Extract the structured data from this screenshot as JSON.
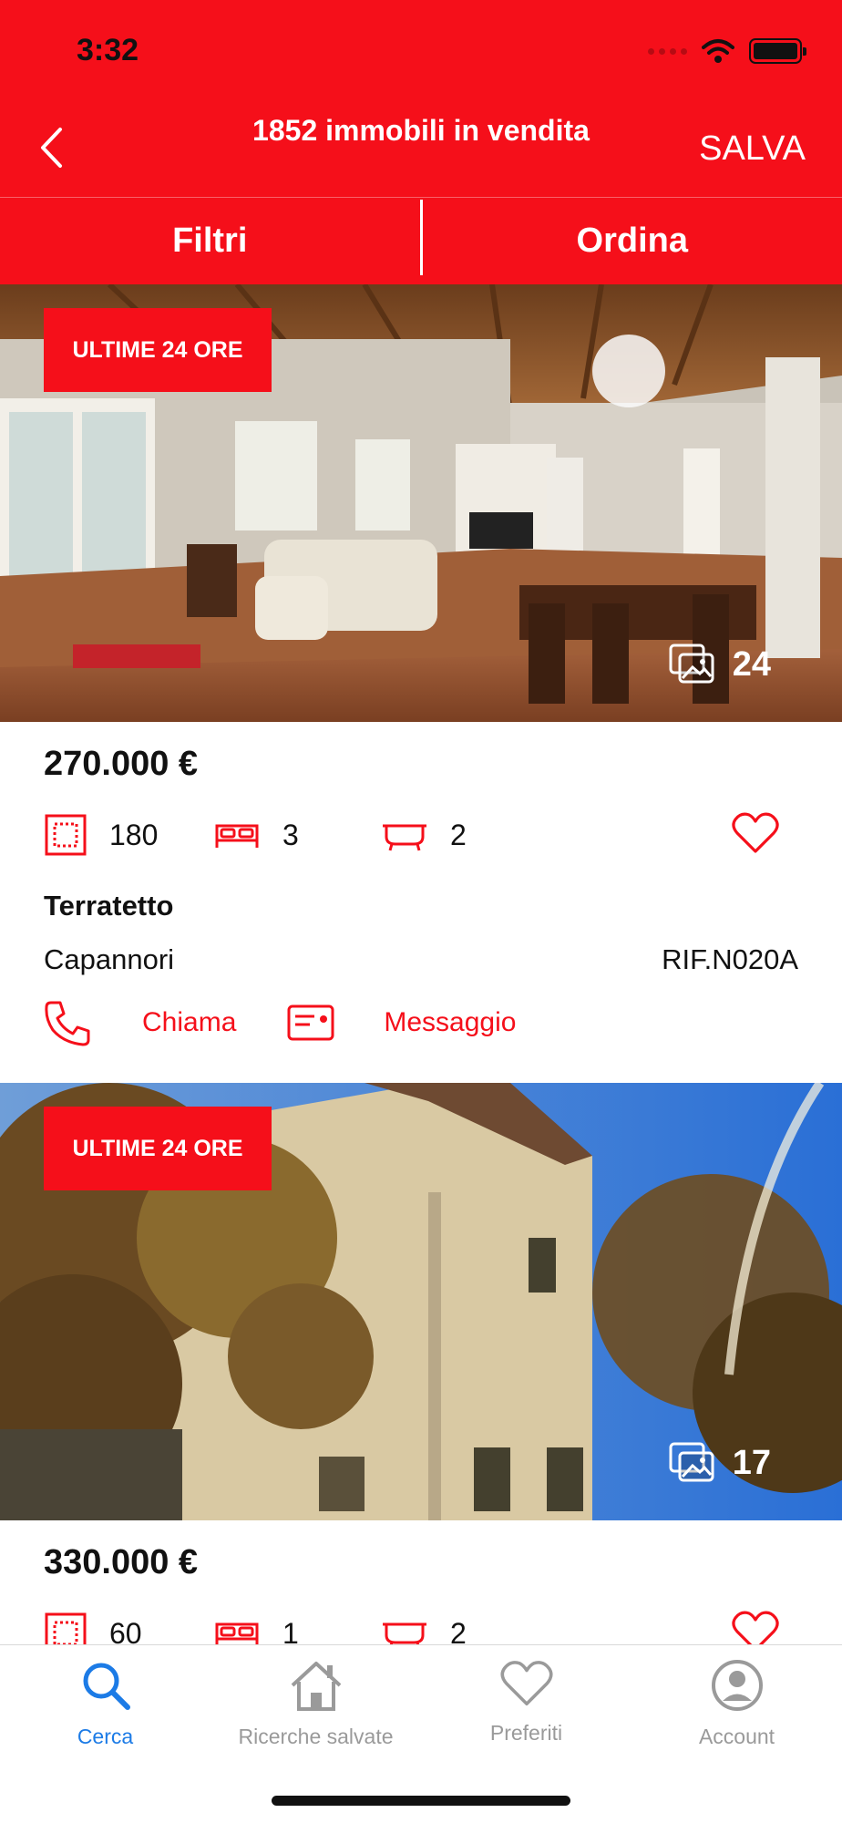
{
  "status_bar": {
    "time": "3:32"
  },
  "header": {
    "title": "1852 immobili in vendita",
    "save_label": "SALVA",
    "filter_label": "Filtri",
    "sort_label": "Ordina"
  },
  "colors": {
    "brand_red": "#f50f1a",
    "tab_active": "#1c7be6",
    "tab_inactive": "#9a9a9a"
  },
  "listings": [
    {
      "badge": "ULTIME 24 ORE",
      "photo_count": "24",
      "price": "270.000 €",
      "surface": "180",
      "bedrooms": "3",
      "bathrooms": "2",
      "type": "Terratetto",
      "city": "Capannori",
      "reference": "RIF.N020A",
      "call_label": "Chiama",
      "message_label": "Messaggio"
    },
    {
      "badge": "ULTIME 24 ORE",
      "photo_count": "17",
      "price": "330.000 €",
      "surface": "60",
      "bedrooms": "1",
      "bathrooms": "2"
    }
  ],
  "tabbar": {
    "items": [
      {
        "label": "Cerca",
        "icon": "search-icon",
        "active": true
      },
      {
        "label": "Ricerche salvate",
        "icon": "house-icon",
        "active": false
      },
      {
        "label": "Preferiti",
        "icon": "heart-icon",
        "active": false
      },
      {
        "label": "Account",
        "icon": "account-icon",
        "active": false
      }
    ]
  }
}
